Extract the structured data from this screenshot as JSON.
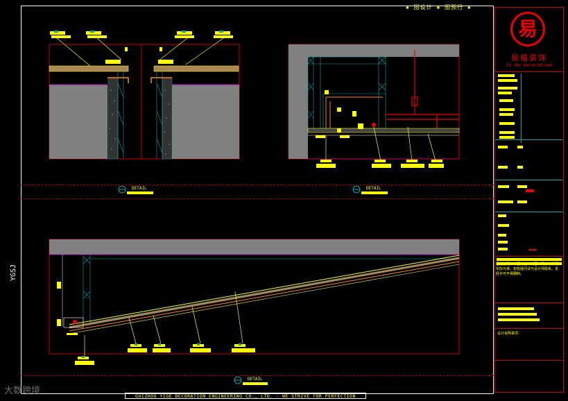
{
  "top_note": "▪ 图设计 ▪  图预行 ▪",
  "title_block": {
    "logo_glyph": "易",
    "company_cn": "易格装饰",
    "company_en": "Yi Ge decoration"
  },
  "notes": {
    "general": "图纸说明：本图为施工详图，尺寸以现场实际为准，如有疑问请与设计师联系。未经许可不得翻制。",
    "extra": "设计说明事项："
  },
  "detail_labels": [
    "DETAIL",
    "DETAIL",
    "DETAIL"
  ],
  "bottom_caption": "GUIZHOU YIGE DECORATION ENGINEERING CO., LTD. - WE STRIVE FOR PERFECTION",
  "side_label": "YGSJ",
  "watermark": "大数跨境",
  "colors": {
    "frame_red": "#cc0000",
    "cad_yellow": "#ffff00",
    "cad_cyan": "#00aaaa",
    "cad_gray": "#808080",
    "cad_orange": "#ff8800",
    "cad_magenta": "#cc00cc"
  }
}
